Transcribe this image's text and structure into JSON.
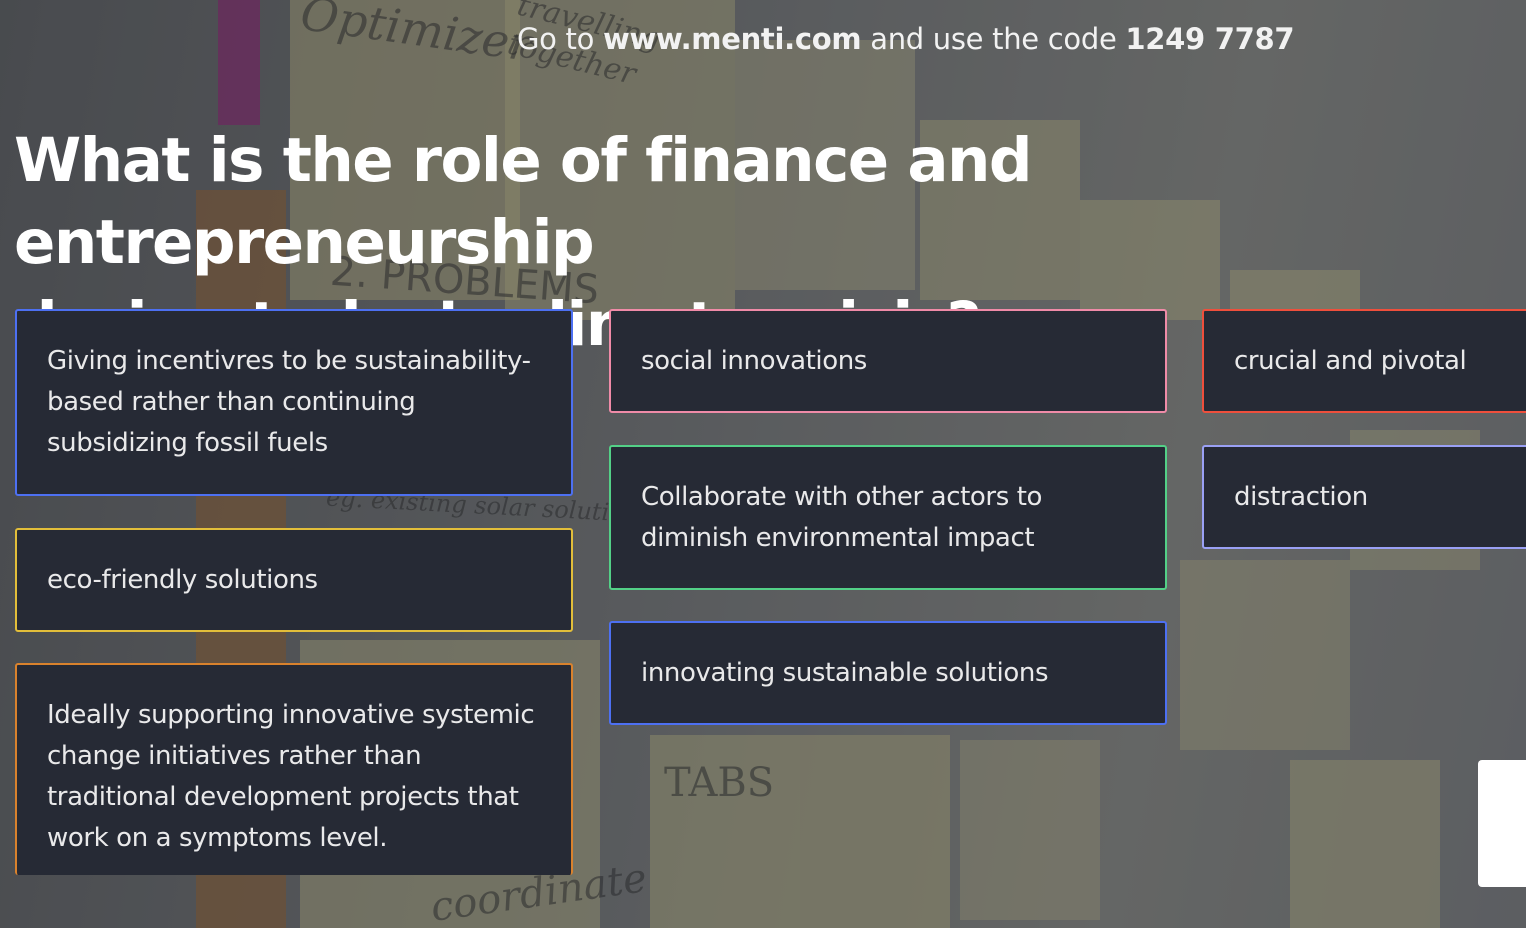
{
  "header": {
    "join_prefix": "Go to",
    "join_url": "www.menti.com",
    "join_middle": "and use the code",
    "join_code": "1249 7787"
  },
  "question": {
    "line1": "What is the role of finance and entrepreneurship",
    "line2": "during today’s climate crisis?"
  },
  "responses": [
    {
      "text": "Giving incentivres to be sustainability-based rather than continuing subsidizing fossil fuels",
      "color": "#4d70f2"
    },
    {
      "text": "eco-friendly solutions",
      "color": "#e2be3a"
    },
    {
      "text": "Ideally supporting innovative systemic change initiatives rather than traditional development projects that work on a symptoms level.",
      "color": "#d9822d"
    },
    {
      "text": "social innovations",
      "color": "#f08ba8"
    },
    {
      "text": "Collaborate with other actors to diminish environmental impact",
      "color": "#53d087"
    },
    {
      "text": "innovating sustainable solutions",
      "color": "#4d70f2"
    },
    {
      "text": "crucial and pivotal",
      "color": "#ef4f3c"
    },
    {
      "text": "distraction",
      "color": "#9aa0f5"
    }
  ],
  "background_text": {
    "note_1": "Optimizer",
    "note_2": "travelling together",
    "note_3": "2. PROBLEMS",
    "note_4": "eg. existing solar solutions",
    "note_5": "TABS",
    "note_6": "coordinate"
  }
}
